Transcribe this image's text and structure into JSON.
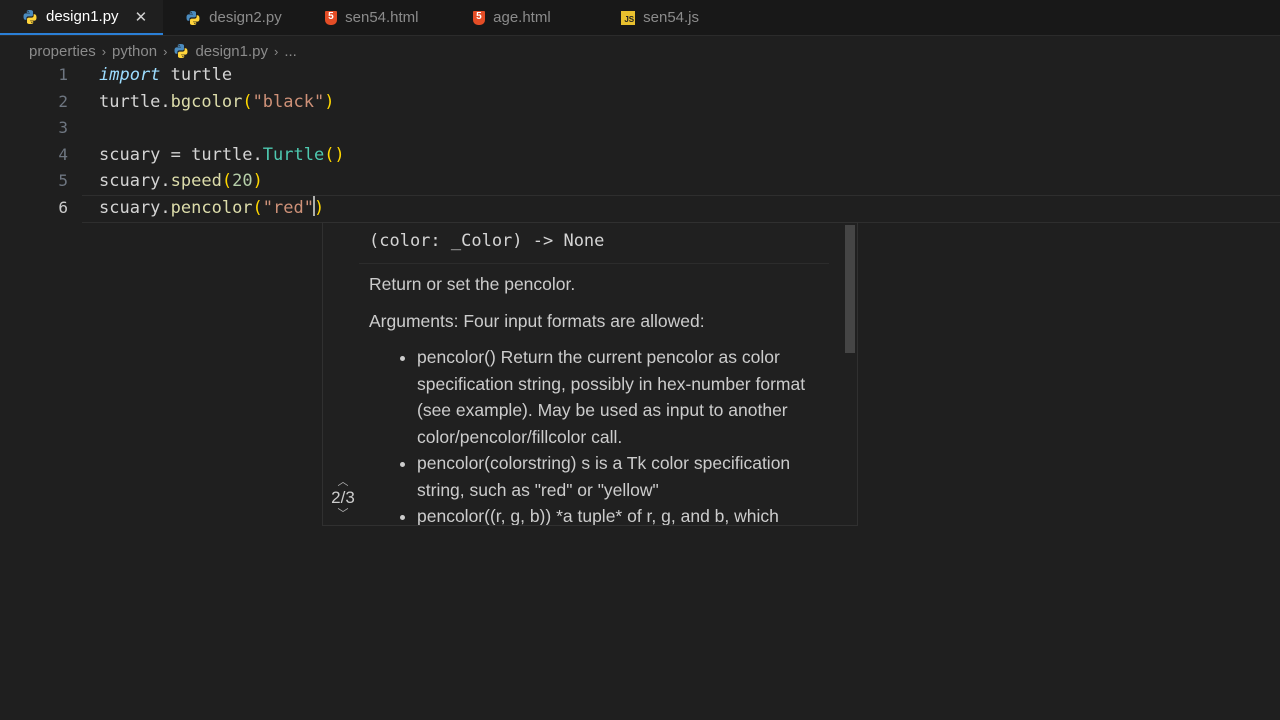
{
  "tabs": [
    {
      "label": "design1.py",
      "icon": "python-icon",
      "active": true
    },
    {
      "label": "design2.py",
      "icon": "python-icon",
      "active": false
    },
    {
      "label": "sen54.html",
      "icon": "html-icon",
      "active": false
    },
    {
      "label": "age.html",
      "icon": "html-icon",
      "active": false
    },
    {
      "label": "sen54.js",
      "icon": "js-icon",
      "active": false
    }
  ],
  "breadcrumb": {
    "items": [
      "properties",
      "python",
      "design1.py",
      "..."
    ]
  },
  "editor": {
    "line_numbers": [
      "1",
      "2",
      "3",
      "4",
      "5",
      "6"
    ],
    "current_line": 6
  },
  "hover": {
    "signature": "(color: _Color) -> None",
    "summary": "Return or set the pencolor.",
    "arguments_intro": "Arguments: Four input formats are allowed:",
    "bullets": [
      "pencolor() Return the current pencolor as color specification string, possibly in hex-number format (see example). May be used as input to another color/pencolor/fillcolor call.",
      "pencolor(colorstring) s is a Tk color specification string, such as \"red\" or \"yellow\"",
      "pencolor((r, g, b)) *a tuple* of r, g, and b, which"
    ],
    "pager": "2/3"
  },
  "colors": {
    "background": "#1f1f1f",
    "tab_active_border": "#2a7fd6",
    "string": "#ce9178",
    "number": "#b5cea8"
  }
}
